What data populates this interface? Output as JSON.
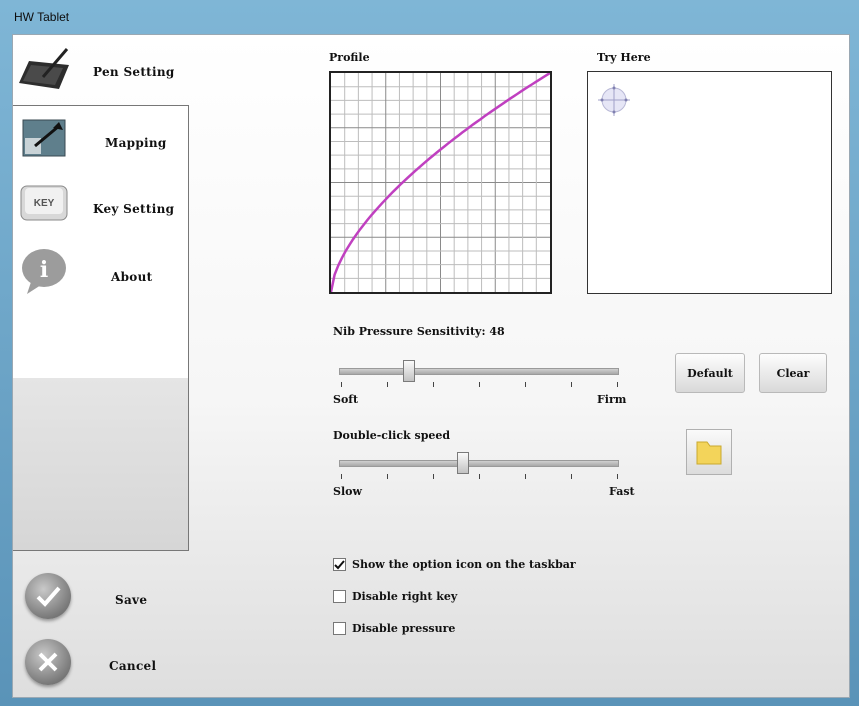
{
  "window": {
    "title": "HW Tablet"
  },
  "sidebar": {
    "items": [
      {
        "label": "Pen Setting",
        "icon": "pen-tablet-icon"
      },
      {
        "label": "Mapping",
        "icon": "mapping-icon"
      },
      {
        "label": "Key Setting",
        "icon": "key-icon"
      },
      {
        "label": "About",
        "icon": "info-icon"
      }
    ],
    "key_icon_text": "KEY",
    "about_icon_text": "i",
    "save_label": "Save",
    "cancel_label": "Cancel"
  },
  "profile": {
    "label": "Profile"
  },
  "try_here": {
    "label": "Try Here"
  },
  "pressure": {
    "label": "Nib Pressure Sensitivity: 48",
    "value": 48,
    "min_label": "Soft",
    "max_label": "Firm"
  },
  "double_click": {
    "label": "Double-click speed",
    "value_fraction": 0.44,
    "min_label": "Slow",
    "max_label": "Fast"
  },
  "buttons": {
    "default_label": "Default",
    "clear_label": "Clear"
  },
  "options": [
    {
      "label": "Show the option icon on the taskbar",
      "checked": true
    },
    {
      "label": "Disable right key",
      "checked": false
    },
    {
      "label": "Disable pressure",
      "checked": false
    }
  ],
  "colors": {
    "curve": "#c040c0",
    "window_frame": "#6fa5c7"
  }
}
